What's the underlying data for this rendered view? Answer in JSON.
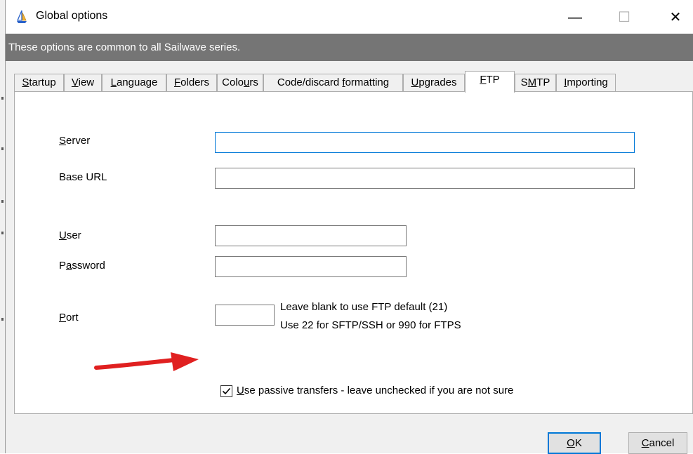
{
  "window": {
    "title": "Global options",
    "minimize_glyph": "—",
    "maximize_glyph": "☐",
    "close_glyph": "✕"
  },
  "infobar": {
    "text": "These options are common to all Sailwave series."
  },
  "tabs": [
    {
      "pre": "",
      "key": "S",
      "post": "tartup"
    },
    {
      "pre": "",
      "key": "V",
      "post": "iew"
    },
    {
      "pre": "",
      "key": "L",
      "post": "anguage"
    },
    {
      "pre": "",
      "key": "F",
      "post": "olders"
    },
    {
      "pre": "Colo",
      "key": "u",
      "post": "rs"
    },
    {
      "pre": "Code/discard ",
      "key": "f",
      "post": "ormatting"
    },
    {
      "pre": "",
      "key": "U",
      "post": "pgrades"
    },
    {
      "pre": "",
      "key": "F",
      "post": "TP"
    },
    {
      "pre": "S",
      "key": "M",
      "post": "TP"
    },
    {
      "pre": "",
      "key": "I",
      "post": "mporting"
    }
  ],
  "active_tab": "FTP",
  "form": {
    "server": {
      "pre": "",
      "key": "S",
      "post": "erver",
      "value": ""
    },
    "base_url": {
      "label": "Base URL",
      "value": ""
    },
    "user": {
      "pre": "",
      "key": "U",
      "post": "ser",
      "value": ""
    },
    "password": {
      "pre": "P",
      "key": "a",
      "post": "ssword",
      "value": ""
    },
    "port": {
      "pre": "",
      "key": "P",
      "post": "ort",
      "value": ""
    },
    "port_hint_line1": "Leave blank to use FTP default (21)",
    "port_hint_line2": "Use 22  for SFTP/SSH or 990 for FTPS",
    "passive": {
      "checked": true,
      "key": "U",
      "rest": "se passive transfers - leave unchecked if you are not sure"
    }
  },
  "buttons": {
    "ok": {
      "key": "O",
      "post": "K"
    },
    "cancel": {
      "key": "C",
      "post": "ancel"
    }
  },
  "colors": {
    "infobar_bg": "#757575",
    "focus_border": "#0078d7",
    "annotation_arrow": "#e02020"
  },
  "icons": {
    "app": "sailboat-icon",
    "checkbox": "checkmark-icon",
    "annotation": "red-arrow-annotation"
  }
}
